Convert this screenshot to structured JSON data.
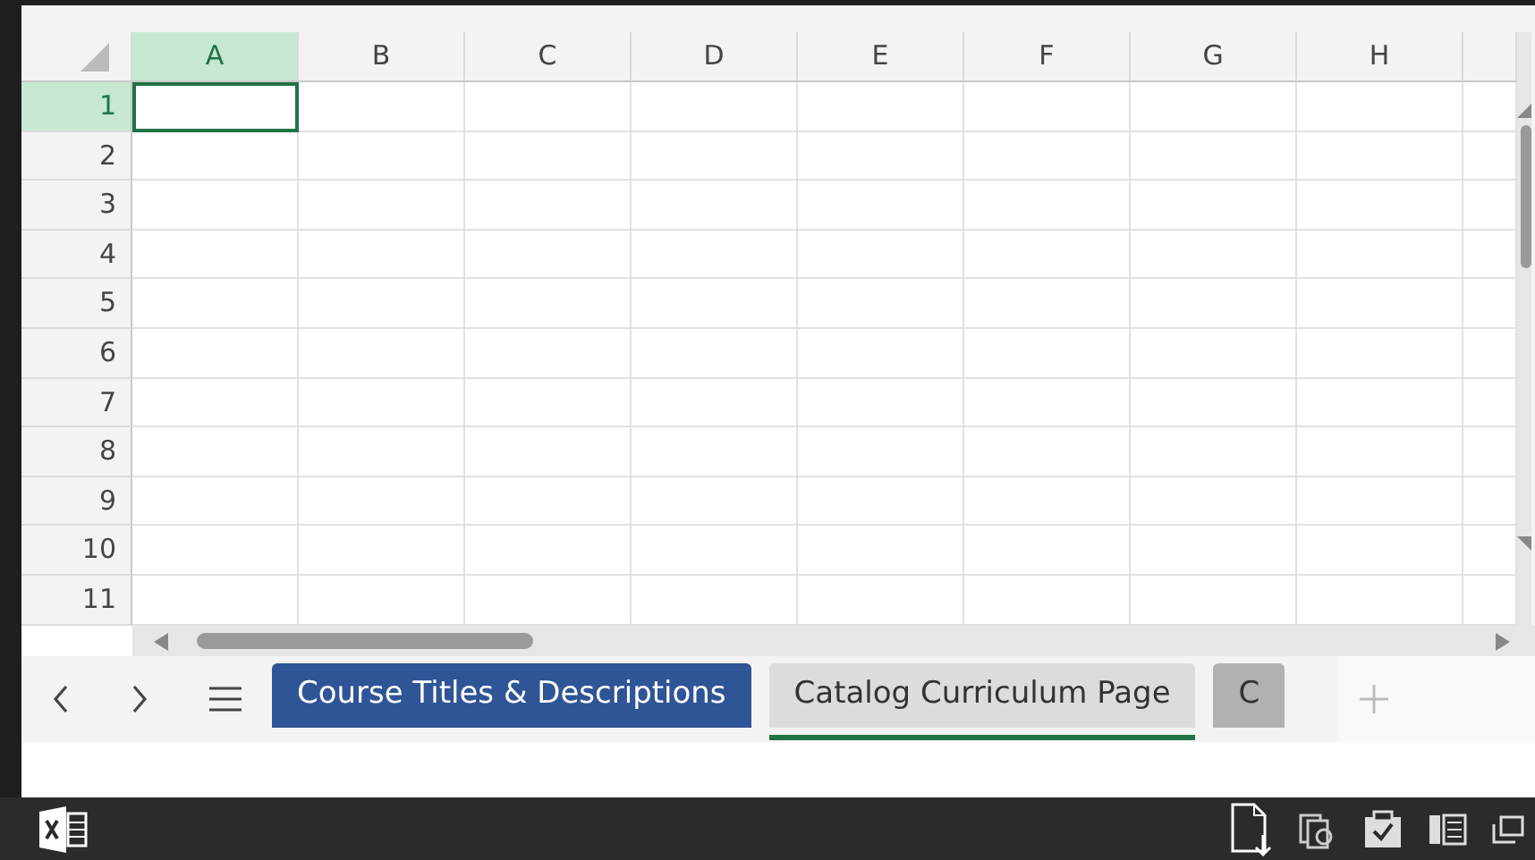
{
  "sheet": {
    "columns": [
      {
        "label": "A",
        "selected": true
      },
      {
        "label": "B",
        "selected": false
      },
      {
        "label": "C",
        "selected": false
      },
      {
        "label": "D",
        "selected": false
      },
      {
        "label": "E",
        "selected": false
      },
      {
        "label": "F",
        "selected": false
      },
      {
        "label": "G",
        "selected": false
      },
      {
        "label": "H",
        "selected": false
      }
    ],
    "rows": [
      {
        "label": "1",
        "selected": true
      },
      {
        "label": "2",
        "selected": false
      },
      {
        "label": "3",
        "selected": false
      },
      {
        "label": "4",
        "selected": false
      },
      {
        "label": "5",
        "selected": false
      },
      {
        "label": "6",
        "selected": false
      },
      {
        "label": "7",
        "selected": false
      },
      {
        "label": "8",
        "selected": false
      },
      {
        "label": "9",
        "selected": false
      },
      {
        "label": "10",
        "selected": false
      },
      {
        "label": "11",
        "selected": false
      }
    ]
  },
  "sheet_tabs": [
    {
      "label": "Course Titles & Descriptions",
      "selected": false,
      "color": "#2f5597"
    },
    {
      "label": "Catalog Curriculum Page",
      "selected": true,
      "color": "#dcdcdc"
    },
    {
      "label": "C",
      "selected": false,
      "color": "#b3b0b0"
    }
  ]
}
